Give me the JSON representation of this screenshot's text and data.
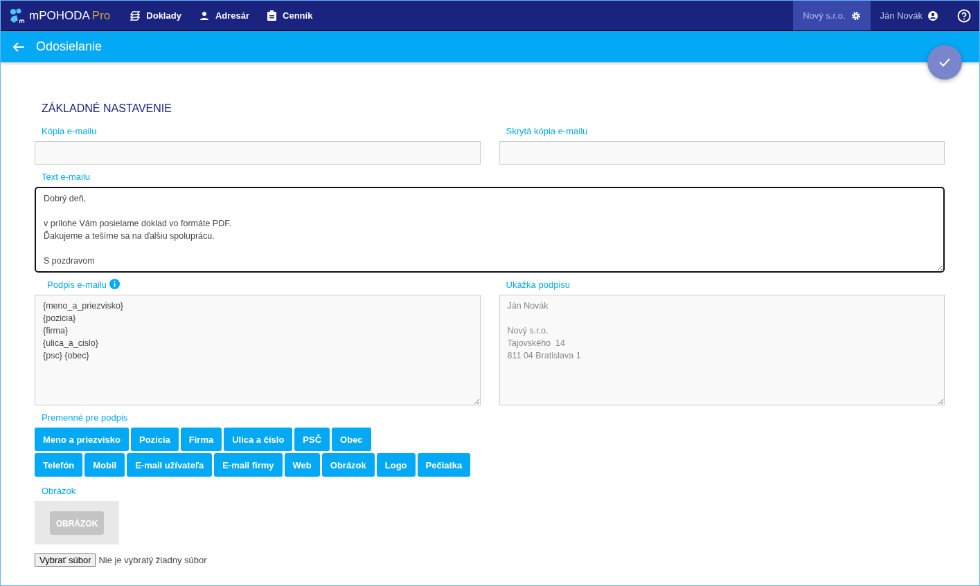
{
  "app": {
    "name": "mPOHODA",
    "edition": "Pro"
  },
  "nav": [
    {
      "label": "Doklady"
    },
    {
      "label": "Adresár"
    },
    {
      "label": "Cenník"
    }
  ],
  "company": "Nový s.r.o.",
  "user": "Ján Novák",
  "page_title": "Odosielanie",
  "section_title": "ZÁKLADNÉ NASTAVENIE",
  "cc": {
    "label": "Kópia e-mailu"
  },
  "bcc": {
    "label": "Skrytá kópia e-mailu"
  },
  "email_text": {
    "label": "Text e-mailu",
    "value": "Dobrý deň,\n\nv prílohe Vám posielame doklad vo formáte PDF.\nĎakujeme a tešíme sa na ďalšiu spoluprácu.\n\nS pozdravom"
  },
  "signature": {
    "label": "Podpis e-mailu",
    "value": "{meno_a_priezvisko}\n{pozicia}\n{firma}\n{ulica_a_cislo}\n{psc} {obec}"
  },
  "signature_preview": {
    "label": "Ukážka podpisu",
    "value": "Ján Novák\n\nNový s.r.o.\nTajovského  14\n811 04 Bratislava 1"
  },
  "variables": {
    "label": "Premenné pre podpis",
    "groups": [
      {
        "buttons": [
          "Meno a priezvisko",
          "Pozícia",
          "Firma",
          "Ulica a číslo",
          "PSČ",
          "Obec"
        ]
      },
      {
        "buttons": [
          "Telefón",
          "Mobil",
          "E-mail užívateľa",
          "E-mail firmy",
          "Web",
          "Obrázok",
          "Logo",
          "Pečiatka"
        ]
      }
    ]
  },
  "image": {
    "label": "Obrázok",
    "placeholder_text": "OBRÁZOK"
  },
  "file_input": {
    "button": "Vybrať súbor",
    "status": "Nie je vybratý žiadny súbor"
  }
}
